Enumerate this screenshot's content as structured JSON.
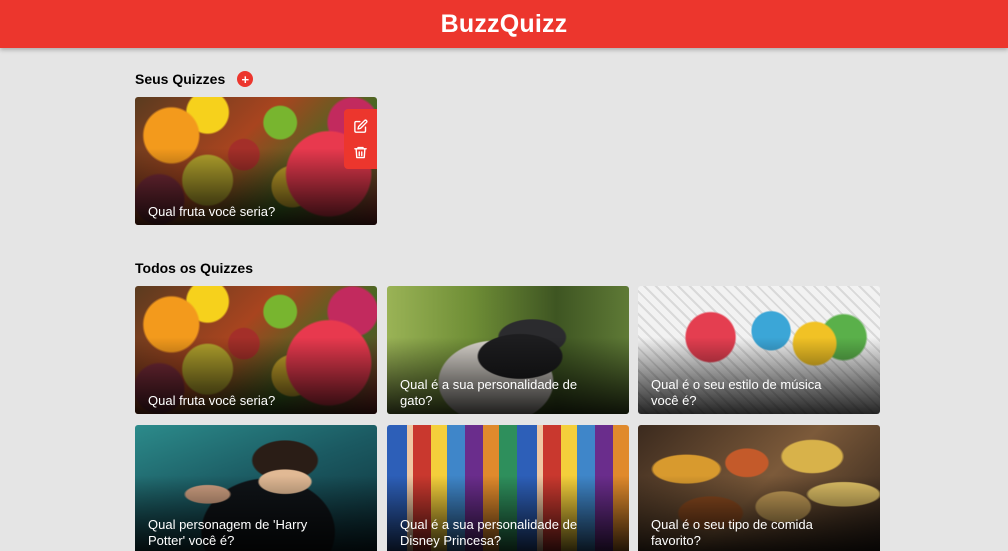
{
  "header": {
    "brand": "BuzzQuizz"
  },
  "my_quizzes": {
    "title": "Seus Quizzes",
    "add_icon": "plus-icon",
    "items": [
      {
        "title": "Qual fruta você seria?",
        "image": "fruits",
        "edit_icon": "edit-icon",
        "delete_icon": "trash-icon"
      }
    ]
  },
  "all_quizzes": {
    "title": "Todos os Quizzes",
    "items": [
      {
        "title": "Qual fruta você seria?",
        "image": "fruits"
      },
      {
        "title": "Qual é a sua personalidade de gato?",
        "image": "cat"
      },
      {
        "title": "Qual é o seu estilo de música você é?",
        "image": "music"
      },
      {
        "title": "Qual personagem de 'Harry Potter' você é?",
        "image": "harry-potter"
      },
      {
        "title": "Qual é a sua personalidade de Disney Princesa?",
        "image": "disney-princesses"
      },
      {
        "title": "Qual é o seu tipo de comida favorito?",
        "image": "food"
      }
    ]
  },
  "colors": {
    "accent": "#ec362d",
    "background": "#e5e5e5"
  }
}
